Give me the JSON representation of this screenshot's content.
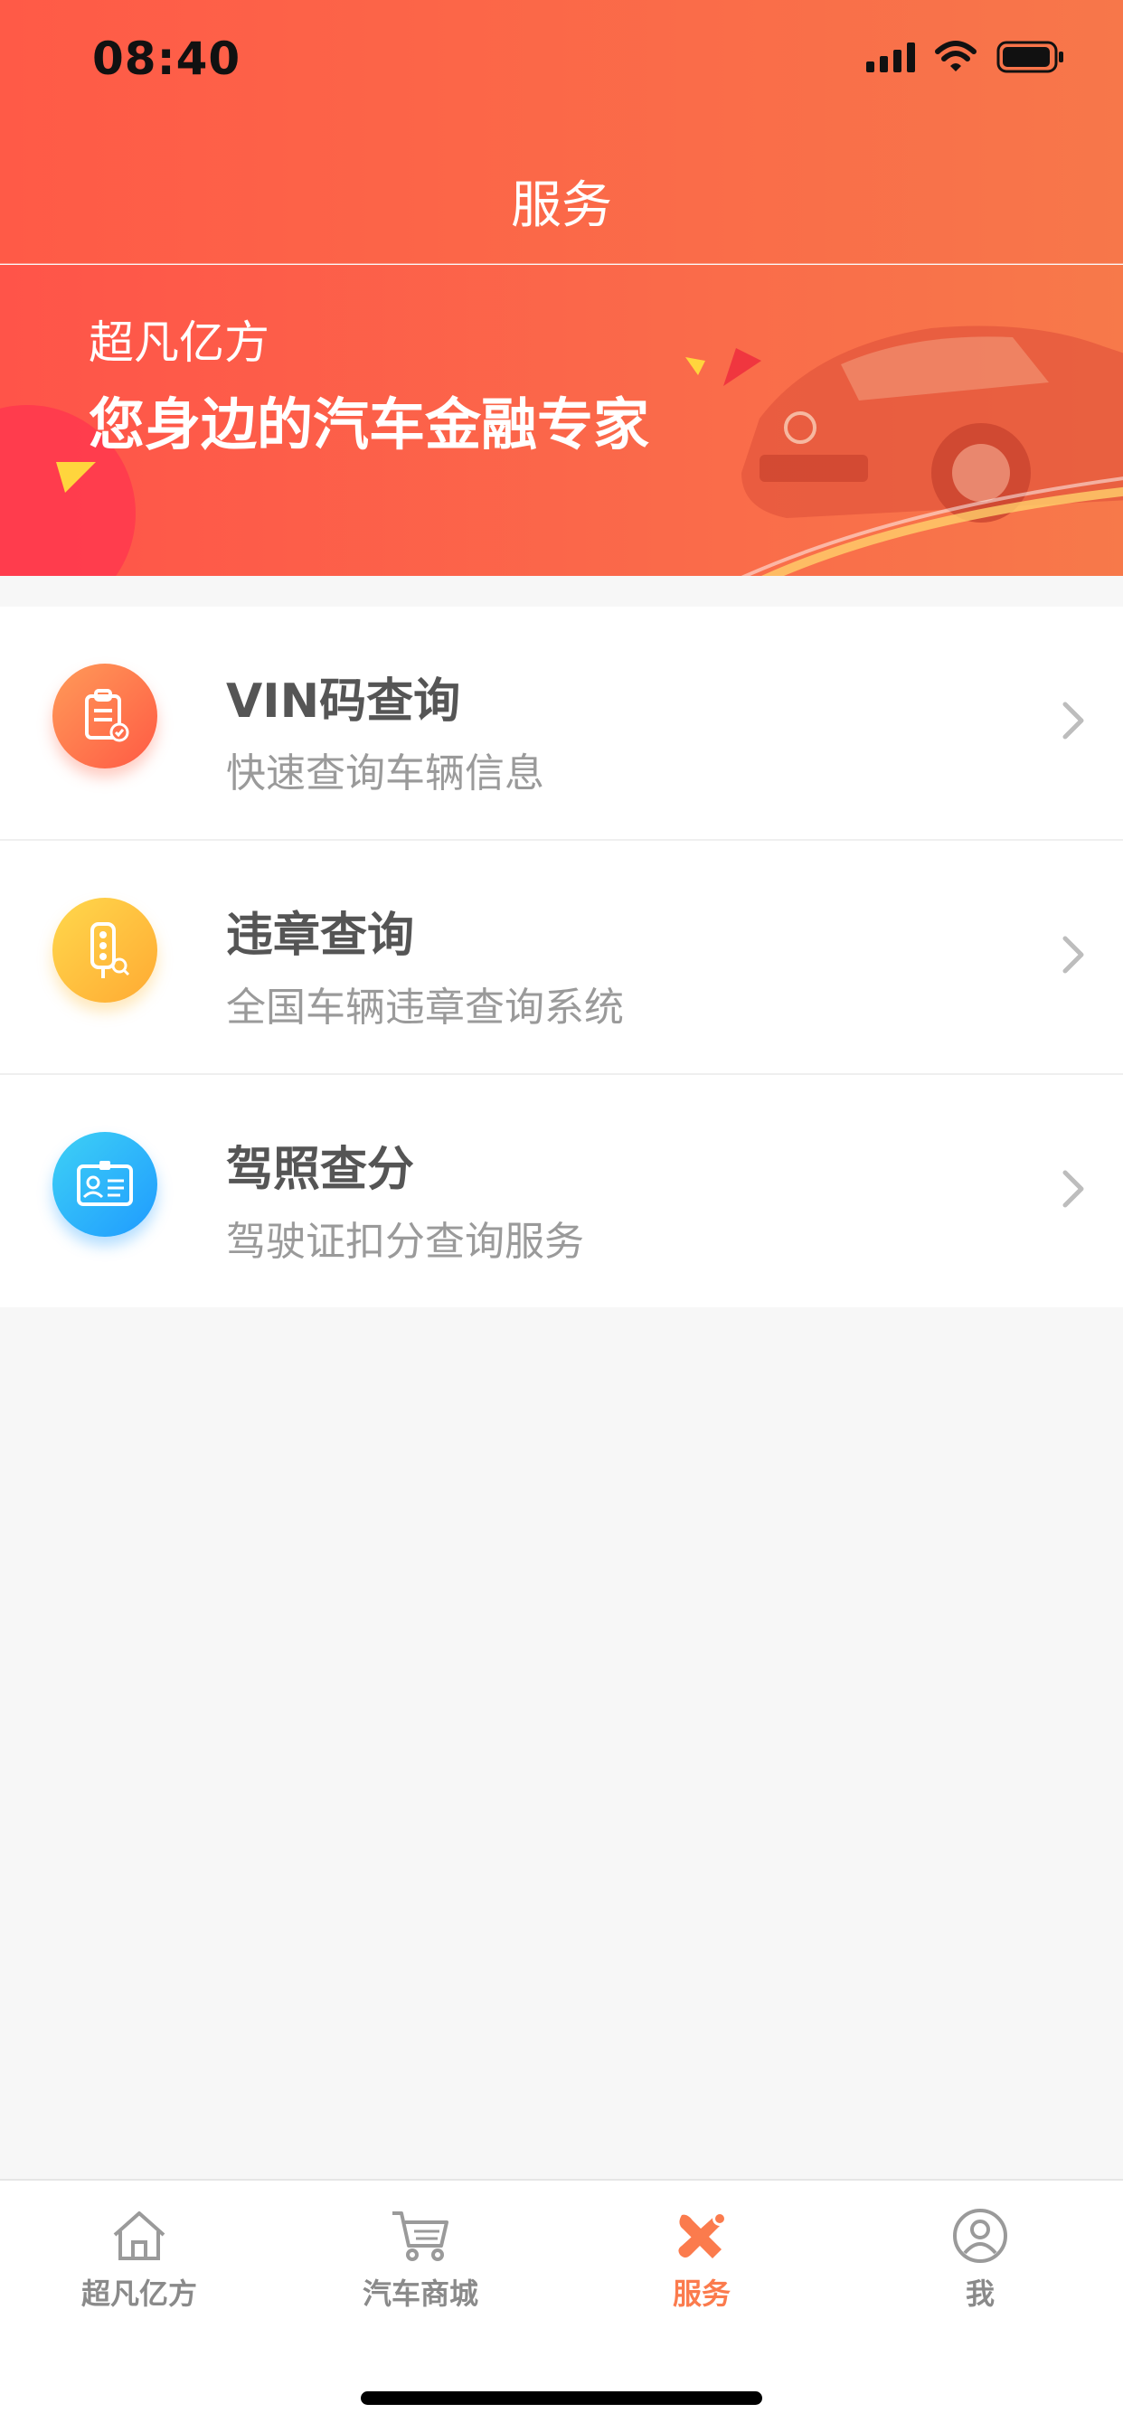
{
  "status_bar": {
    "time": "08:40"
  },
  "nav": {
    "title": "服务"
  },
  "banner": {
    "brand": "超凡亿方",
    "slogan": "您身边的汽车金融专家"
  },
  "services": [
    {
      "title": "VIN码查询",
      "subtitle": "快速查询车辆信息",
      "icon": "vin-clipboard-icon",
      "color": "#ff6f4c"
    },
    {
      "title": "违章查询",
      "subtitle": "全国车辆违章查询系统",
      "icon": "traffic-light-icon",
      "color": "#ffc13c"
    },
    {
      "title": "驾照查分",
      "subtitle": "驾驶证扣分查询服务",
      "icon": "license-card-icon",
      "color": "#28aaff"
    }
  ],
  "tabbar": {
    "items": [
      {
        "label": "超凡亿方",
        "icon": "home-icon",
        "active": false
      },
      {
        "label": "汽车商城",
        "icon": "cart-icon",
        "active": false
      },
      {
        "label": "服务",
        "icon": "tools-icon",
        "active": true
      },
      {
        "label": "我",
        "icon": "profile-icon",
        "active": false
      }
    ],
    "active_color": "#fb7b4d"
  },
  "colors": {
    "header_start": "#ff5a47",
    "header_end": "#f7774a",
    "text_title": "#555555",
    "text_sub": "#9a9a9a"
  }
}
